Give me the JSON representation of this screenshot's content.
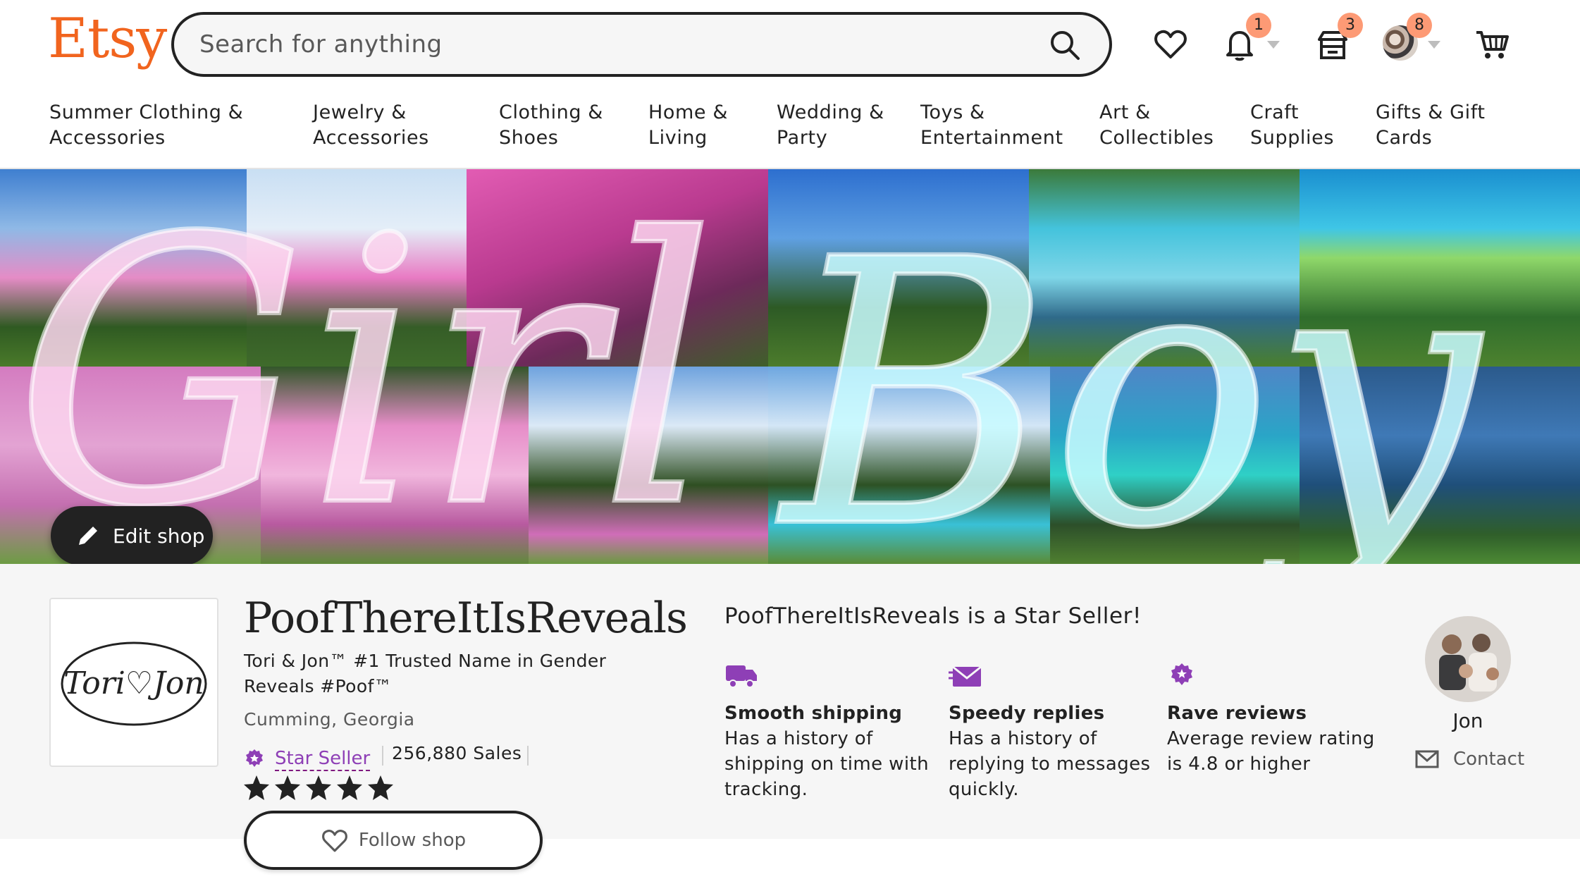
{
  "header": {
    "logo": "Etsy",
    "search_placeholder": "Search for anything",
    "notifications_count": "1",
    "shop_manager_count": "3",
    "account_count": "8"
  },
  "nav": {
    "items": [
      {
        "line1": "Summer Clothing &",
        "line2": "Accessories"
      },
      {
        "line1": "Jewelry &",
        "line2": "Accessories"
      },
      {
        "line1": "Clothing &",
        "line2": "Shoes"
      },
      {
        "line1": "Home &",
        "line2": "Living"
      },
      {
        "line1": "Wedding &",
        "line2": "Party"
      },
      {
        "line1": "Toys &",
        "line2": "Entertainment"
      },
      {
        "line1": "Art &",
        "line2": "Collectibles"
      },
      {
        "line1": "Craft",
        "line2": "Supplies"
      },
      {
        "line1": "Gifts & Gift",
        "line2": "Cards"
      }
    ]
  },
  "banner": {
    "left_word": "Girl",
    "right_word": "Boy",
    "edit_shop_label": "Edit shop"
  },
  "shop": {
    "logo_text": "Tori♡Jon",
    "name": "PoofThereItIsReveals",
    "tagline": "Tori & Jon™ #1 Trusted Name in Gender Reveals #Poof™",
    "location": "Cumming, Georgia",
    "star_seller_label": "Star Seller",
    "sales": "256,880 Sales",
    "rating_stars": 5,
    "follow_label": "Follow shop"
  },
  "star_seller": {
    "headline": "PoofThereItIsReveals is a Star Seller!",
    "badges": [
      {
        "icon": "truck-icon",
        "title": "Smooth shipping",
        "desc": "Has a history of shipping on time with tracking."
      },
      {
        "icon": "message-icon",
        "title": "Speedy replies",
        "desc": "Has a history of replying to messages quickly."
      },
      {
        "icon": "star-badge-icon",
        "title": "Rave reviews",
        "desc": "Average review rating is 4.8 or higher"
      }
    ]
  },
  "owner": {
    "name": "Jon",
    "contact_label": "Contact"
  },
  "colors": {
    "brand": "#f1641e",
    "badge": "#fd9a75",
    "star_seller_purple": "#8e3fb6",
    "dark": "#222222"
  }
}
